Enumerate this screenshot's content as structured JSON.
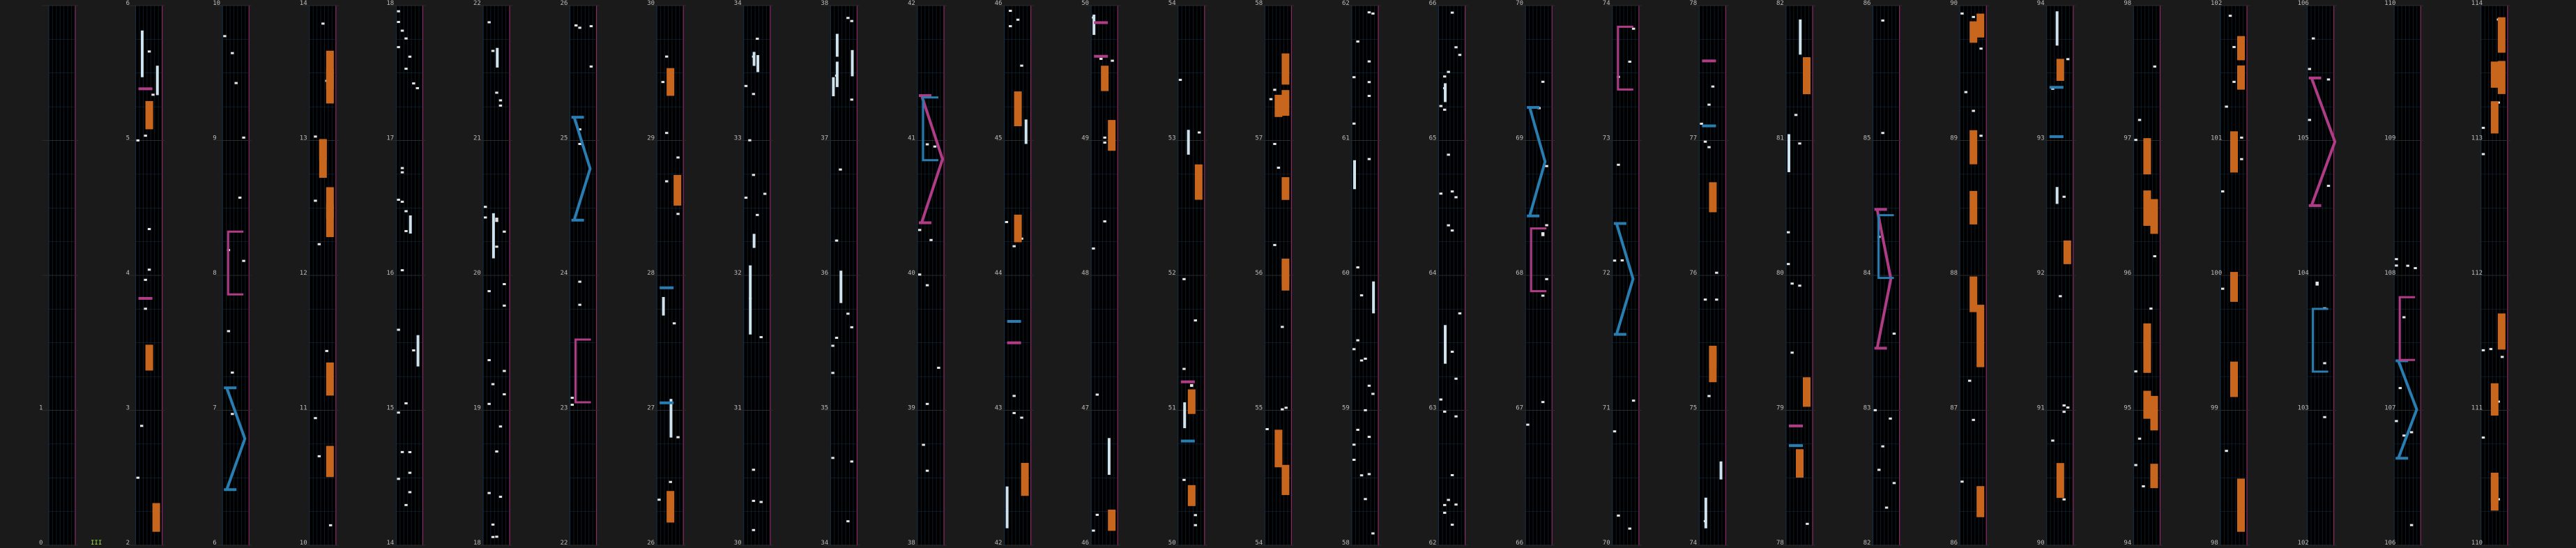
{
  "app": "rhythm-chart-preview",
  "theme": {
    "background": "#1a1a1a",
    "lane_bg": "#000000",
    "beat_line": "#15324c",
    "row_line": "#2a2a2a",
    "right_border": "#8a2a6a",
    "tap_note": "#e6e6e6",
    "hold_note": "#cfe3ef",
    "flick_orange": "#c8661e",
    "slide_blue": "#2a7db0",
    "slide_pink": "#b03c86",
    "start_marker": "#9be84a"
  },
  "chart_data": {
    "type": "rhythm-game-chart",
    "bpm_marker": "III",
    "measures_per_column": 4,
    "total_measures": 118,
    "columns": [
      {
        "measures": [
          0,
          1,
          2,
          3
        ],
        "measure_labels": [
          "0",
          "1",
          "2",
          "3"
        ],
        "labels_shown": [
          true,
          true,
          false,
          false
        ],
        "pattern": "empty"
      },
      {
        "measures": [
          2,
          3,
          4,
          5,
          6
        ],
        "measure_labels": [
          "2",
          "3",
          "4",
          "5",
          "6"
        ],
        "pattern": "mixed"
      },
      {
        "measures": [
          6,
          7,
          8,
          9,
          10
        ],
        "measure_labels": [
          "6",
          "7",
          "8",
          "9",
          "10"
        ],
        "pattern": "slide"
      },
      {
        "measures": [
          10,
          11,
          12,
          13,
          14
        ],
        "measure_labels": [
          "10",
          "11",
          "12",
          "13",
          "14"
        ],
        "pattern": "flick"
      },
      {
        "measures": [
          14,
          15,
          16,
          17,
          18
        ],
        "measure_labels": [
          "14",
          "15",
          "16",
          "17",
          "18"
        ],
        "pattern": "tap"
      },
      {
        "measures": [
          18,
          19,
          20,
          21,
          22
        ],
        "measure_labels": [
          "18",
          "19",
          "20",
          "21",
          "22"
        ],
        "pattern": "tap"
      },
      {
        "measures": [
          22,
          23,
          24,
          25,
          26
        ],
        "measure_labels": [
          "22",
          "23",
          "24",
          "25",
          "26"
        ],
        "pattern": "slide"
      },
      {
        "measures": [
          26,
          27,
          28,
          29,
          30
        ],
        "measure_labels": [
          "26",
          "27",
          "28",
          "29",
          "30"
        ],
        "pattern": "mixed"
      },
      {
        "measures": [
          30,
          31,
          32,
          33,
          34
        ],
        "measure_labels": [
          "30",
          "31",
          "32",
          "33",
          "34"
        ],
        "pattern": "hold"
      },
      {
        "measures": [
          34,
          35,
          36,
          37,
          38
        ],
        "measure_labels": [
          "34",
          "35",
          "36",
          "37",
          "38"
        ],
        "pattern": "hold"
      },
      {
        "measures": [
          38,
          39,
          40,
          41,
          42
        ],
        "measure_labels": [
          "38",
          "39",
          "40",
          "41",
          "42"
        ],
        "pattern": "slide"
      },
      {
        "measures": [
          42,
          43,
          44,
          45,
          46
        ],
        "measure_labels": [
          "42",
          "43",
          "44",
          "45",
          "46"
        ],
        "pattern": "mixed"
      },
      {
        "measures": [
          46,
          47,
          48,
          49,
          50
        ],
        "measure_labels": [
          "46",
          "47",
          "48",
          "49",
          "50"
        ],
        "pattern": "mixed"
      },
      {
        "measures": [
          50,
          51,
          52,
          53,
          54
        ],
        "measure_labels": [
          "50",
          "51",
          "52",
          "53",
          "54"
        ],
        "pattern": "mixed"
      },
      {
        "measures": [
          54,
          55,
          56,
          57,
          58
        ],
        "measure_labels": [
          "54",
          "55",
          "56",
          "57",
          "58"
        ],
        "pattern": "flick"
      },
      {
        "measures": [
          58,
          59,
          60,
          61,
          62
        ],
        "measure_labels": [
          "58",
          "59",
          "60",
          "61",
          "62"
        ],
        "pattern": "tap"
      },
      {
        "measures": [
          62,
          63,
          64,
          65,
          66
        ],
        "measure_labels": [
          "62",
          "63",
          "64",
          "65",
          "66"
        ],
        "pattern": "tap"
      },
      {
        "measures": [
          66,
          67,
          68,
          69,
          70
        ],
        "measure_labels": [
          "66",
          "67",
          "68",
          "69",
          "70"
        ],
        "pattern": "slide"
      },
      {
        "measures": [
          70,
          71,
          72,
          73,
          74
        ],
        "measure_labels": [
          "70",
          "71",
          "72",
          "73",
          "74"
        ],
        "pattern": "slide"
      },
      {
        "measures": [
          74,
          75,
          76,
          77,
          78
        ],
        "measure_labels": [
          "74",
          "75",
          "76",
          "77",
          "78"
        ],
        "pattern": "mixed"
      },
      {
        "measures": [
          78,
          79,
          80,
          81,
          82
        ],
        "measure_labels": [
          "78",
          "79",
          "80",
          "81",
          "82"
        ],
        "pattern": "mixed"
      },
      {
        "measures": [
          82,
          83,
          84,
          85,
          86
        ],
        "measure_labels": [
          "82",
          "83",
          "84",
          "85",
          "86"
        ],
        "pattern": "slide"
      },
      {
        "measures": [
          86,
          87,
          88,
          89,
          90
        ],
        "measure_labels": [
          "86",
          "87",
          "88",
          "89",
          "90"
        ],
        "pattern": "flick"
      },
      {
        "measures": [
          90,
          91,
          92,
          93,
          94
        ],
        "measure_labels": [
          "90",
          "91",
          "92",
          "93",
          "94"
        ],
        "pattern": "mixed"
      },
      {
        "measures": [
          94,
          95,
          96,
          97,
          98
        ],
        "measure_labels": [
          "94",
          "95",
          "96",
          "97",
          "98"
        ],
        "pattern": "flick"
      },
      {
        "measures": [
          98,
          99,
          100,
          101,
          102
        ],
        "measure_labels": [
          "98",
          "99",
          "100",
          "101",
          "102"
        ],
        "pattern": "flick"
      },
      {
        "measures": [
          102,
          103,
          104,
          105,
          106
        ],
        "measure_labels": [
          "102",
          "103",
          "104",
          "105",
          "106"
        ],
        "pattern": "slide"
      },
      {
        "measures": [
          106,
          107,
          108,
          109,
          110
        ],
        "measure_labels": [
          "106",
          "107",
          "108",
          "109",
          "110"
        ],
        "pattern": "slide"
      },
      {
        "measures": [
          110,
          111,
          112,
          113,
          114
        ],
        "measure_labels": [
          "110",
          "111",
          "112",
          "113",
          "114"
        ],
        "pattern": "flick"
      }
    ]
  }
}
